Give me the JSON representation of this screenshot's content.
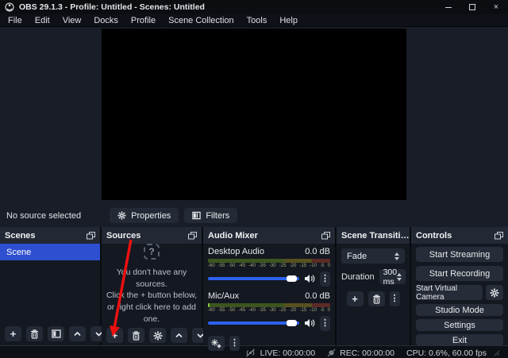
{
  "window": {
    "title": "OBS 29.1.3 - Profile: Untitled - Scenes: Untitled"
  },
  "menu": {
    "items": [
      "File",
      "Edit",
      "View",
      "Docks",
      "Profile",
      "Scene Collection",
      "Tools",
      "Help"
    ]
  },
  "selection_bar": {
    "status": "No source selected",
    "properties_label": "Properties",
    "filters_label": "Filters"
  },
  "scenes": {
    "title": "Scenes",
    "items": [
      {
        "label": "Scene",
        "selected": true
      }
    ]
  },
  "sources": {
    "title": "Sources",
    "empty_icon": "?",
    "hint_line1": "You don't have any sources.",
    "hint_line2": "Click the + button below,",
    "hint_line3": "or right click here to add one."
  },
  "mixer": {
    "title": "Audio Mixer",
    "channels": [
      {
        "name": "Desktop Audio",
        "level": "0.0 dB"
      },
      {
        "name": "Mic/Aux",
        "level": "0.0 dB"
      }
    ],
    "ticks": [
      "-60",
      "-55",
      "-50",
      "-45",
      "-40",
      "-35",
      "-30",
      "-25",
      "-20",
      "-15",
      "-10",
      "-5",
      "0"
    ]
  },
  "transitions": {
    "title": "Scene Transiti…",
    "transition_value": "Fade",
    "duration_label": "Duration",
    "duration_value": "300 ms"
  },
  "controls_panel": {
    "title": "Controls",
    "start_streaming": "Start Streaming",
    "start_recording": "Start Recording",
    "start_virtual_camera": "Start Virtual Camera",
    "studio_mode": "Studio Mode",
    "settings": "Settings",
    "exit": "Exit"
  },
  "statusbar": {
    "live": "LIVE: 00:00:00",
    "rec": "REC: 00:00:00",
    "perf": "CPU: 0.6%, 60.00 fps"
  },
  "colors": {
    "selection_blue": "#2e4fd0",
    "slider_blue": "#2d62f0",
    "arrow_red": "#ee1010",
    "meter_green": "#3c551f",
    "meter_yellow": "#56511f",
    "meter_red": "#5c2a26"
  }
}
